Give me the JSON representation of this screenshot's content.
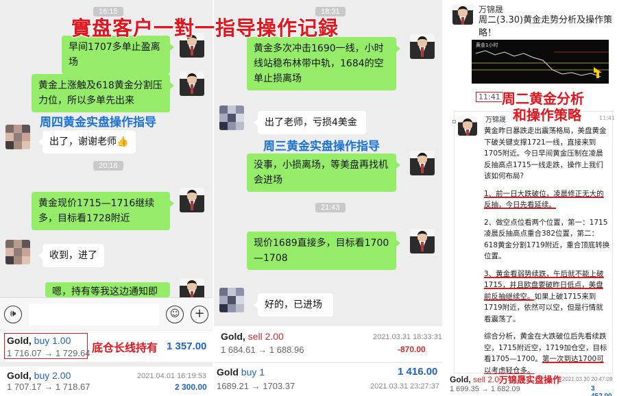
{
  "overlays": {
    "main_title": "實盘客户一對一指导操作记録",
    "p1_label": "周四黄金实盘操作指导",
    "p2_label": "周三黄金实盘操作指导",
    "p3_label_line1": "周二黄金分析",
    "p3_label_line2": "和操作策略",
    "p1_trade_label": "底仓长线持有",
    "p3_trade_label": "万锦晟实盘操作"
  },
  "colors": {
    "bubble_green": "#95ec69",
    "overlay_red": "#e3141c",
    "overlay_blue": "#1b72d8",
    "buy_blue": "#1e62c8",
    "loss_red": "#d02c2c"
  },
  "panel1": {
    "time1": "16:15",
    "msg1": "早间1707多单止盈离场",
    "msg2": "黄金上涨触及618黄金分割压力位，所以多单先出来",
    "msg3": "出了，谢谢老师",
    "msg3_emoji": "👍",
    "time2": "20:18",
    "msg4": "黄金现价1715—1716继续多，目标看1728附近",
    "msg5": "收到，进了",
    "msg6": "嗯，持有等我这边通知即可",
    "trades": [
      {
        "symbol": "Gold,",
        "side": "buy 1.00",
        "prices": "1 716.07 → 1 729.64",
        "datetime": "",
        "pnl": "1 357.00"
      },
      {
        "symbol": "Gold,",
        "side": "buy 2.00",
        "prices": "1 707.17 → 1 718.67",
        "datetime": "2021.04.01 16:19:53",
        "pnl": "2 300.00"
      }
    ]
  },
  "panel2": {
    "time1": "18:31",
    "msg1": "黄金多次冲击1690一线，小时线站稳布林带中轨，1684的空单止损离场",
    "msg2": "出了老师，亏损4美金",
    "msg3": "没事，小损离场，等美盘再找机会进场",
    "time2": "21:43",
    "msg4": "现价1689直接多，目标看1700—1708",
    "msg5": "好的，已进场",
    "trades": [
      {
        "symbol": "Gold,",
        "side": "sell 2.00",
        "prices": "1 684.61 → 1 688.96",
        "datetime": "2021.03.31 18:33:31",
        "pnl": "-870.00"
      },
      {
        "symbol": "Gold",
        "side": "buy 1",
        "prices": "1689.21 → 1703.37",
        "datetime": "2021.03.31 23:27:37",
        "pnl": "1 416.00"
      }
    ]
  },
  "panel3": {
    "author": "万锦晟",
    "post_title": "周二(3.30)黄金走势分析及操作策略！",
    "chart_caption": "黄金1小时",
    "time_stamp": "11:41",
    "time_stamp2": "11:41",
    "author2": "万锦晟",
    "para1": "黄金昨日暴跌走出震荡格局，美盘黄金下破关键支撑1721一线，直接来到1705附近。今日早间黄金压制在凌晨反抽高点1715一线走跌，操作上我们该如何布局?",
    "para2": "1、前一日大跌破位，凌晨修正无大的反抽，今日先看延续。",
    "para3": "2、做空点位看两个位置，第一：1715凌晨反抽高点重合382位置，第二：618黄金分割1719附近，重合顶底转换位置。",
    "para4a": "3、黄金看弱势续跌，午后就不能上破1715，并且欧盘要破昨日低点，美盘前反抽继续空。",
    "para4b": "如果上破1715来到1719附近，依然可以空，但是行情就看震荡了。",
    "para5a": "综合分析，黄金在大跌破位后先看续跌空，1715附近空，1719加仓空，目标看1705—1700。",
    "para5b": "第一次到达1700可以考虑轻仓多。",
    "trade": {
      "symbol": "Gold,",
      "side": "sell 2.00",
      "prices": "1 699.35 → 1 682.09",
      "datetime": "2021.03.30 20:47:09",
      "pnl": "3 452.00"
    }
  }
}
